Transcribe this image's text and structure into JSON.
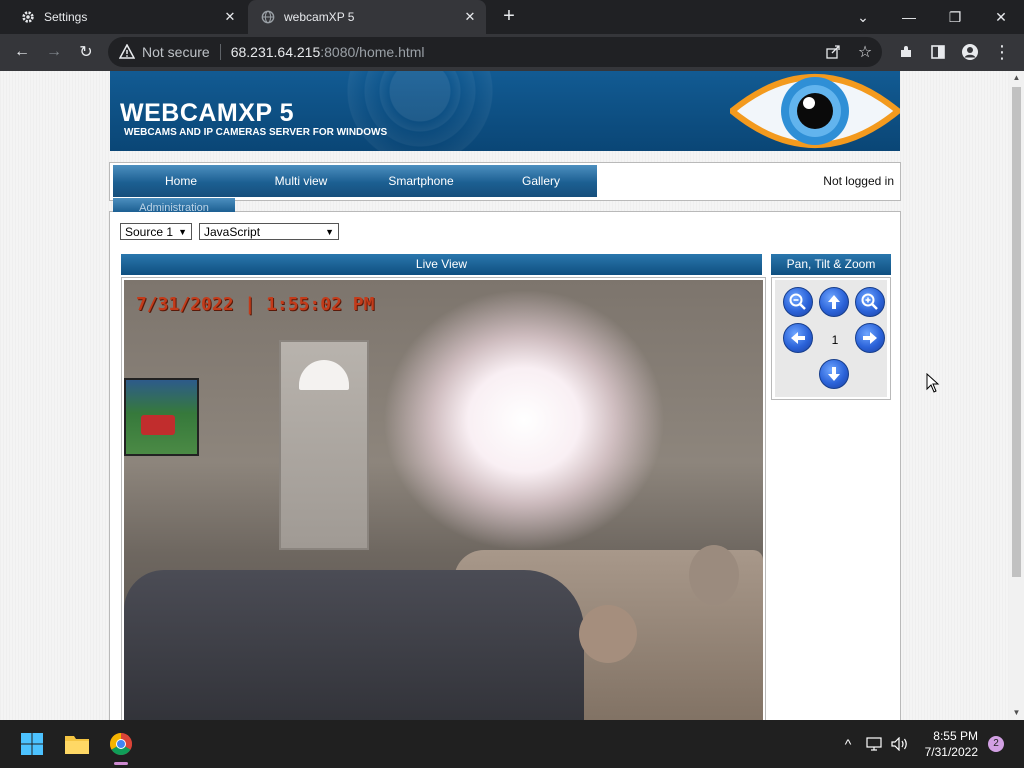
{
  "browser": {
    "tabs": [
      {
        "title": "Settings",
        "icon": "gear-icon"
      },
      {
        "title": "webcamXP 5",
        "icon": "globe-icon"
      }
    ],
    "security_label": "Not secure",
    "url_host": "68.231.64.215",
    "url_path": ":8080/home.html"
  },
  "page": {
    "banner_title": "WEBCAMXP 5",
    "banner_subtitle": "WEBCAMS AND IP CAMERAS SERVER FOR WINDOWS",
    "nav": [
      {
        "label": "Home"
      },
      {
        "label": "Multi view"
      },
      {
        "label": "Smartphone"
      },
      {
        "label": "Gallery"
      },
      {
        "label": "Administration"
      }
    ],
    "login_status": "Not logged in",
    "source_select": "Source 1",
    "mode_select": "JavaScript",
    "live_view_title": "Live View",
    "camera_timestamp": "7/31/2022 | 1:55:02 PM",
    "ptz_title": "Pan, Tilt & Zoom",
    "ptz_preset": "1"
  },
  "taskbar": {
    "time": "8:55 PM",
    "date": "7/31/2022",
    "notification_count": "2"
  },
  "colors": {
    "banner_blue": "#0d4f82",
    "nav_blue": "#1c5f92",
    "timestamp": "#c33b1a"
  }
}
